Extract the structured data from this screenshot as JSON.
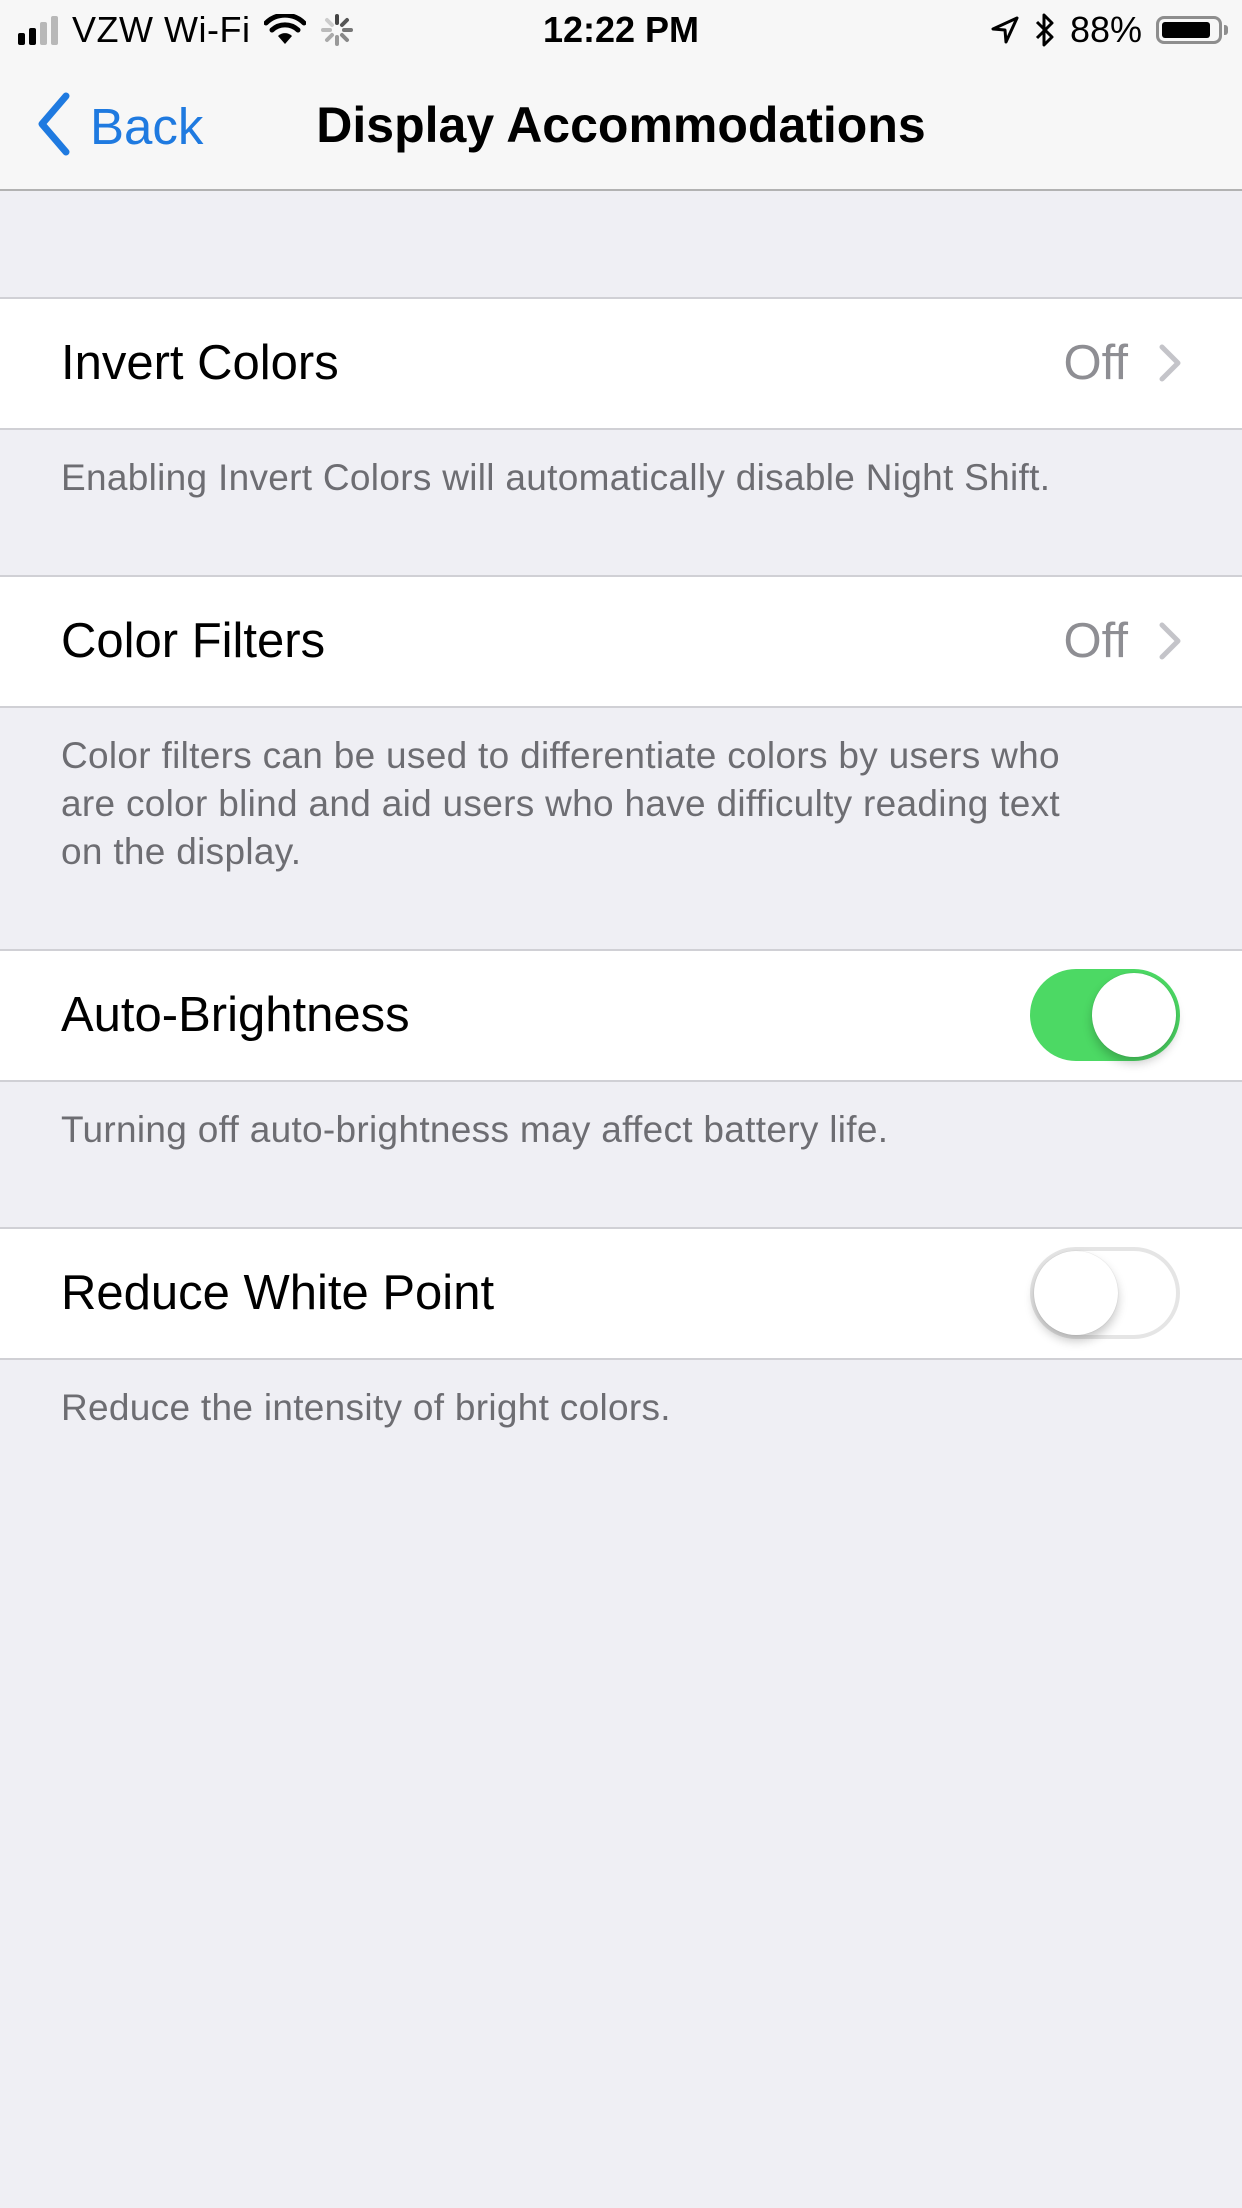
{
  "status_bar": {
    "carrier": "VZW Wi-Fi",
    "time": "12:22 PM",
    "battery_percent": "88%",
    "signal_bars_filled": 2,
    "signal_bars_total": 4,
    "icons": [
      "signal-icon",
      "wifi-icon",
      "activity-spinner-icon",
      "location-arrow-icon",
      "bluetooth-icon",
      "battery-icon"
    ]
  },
  "nav": {
    "back_label": "Back",
    "title": "Display Accommodations"
  },
  "sections": [
    {
      "label": "Invert Colors",
      "type": "disclosure",
      "value": "Off",
      "footer": "Enabling Invert Colors will automatically disable Night Shift."
    },
    {
      "label": "Color Filters",
      "type": "disclosure",
      "value": "Off",
      "footer_lines": [
        "Color filters can be used to differentiate colors by users who",
        "are color blind and aid users who have difficulty reading text",
        "on the display."
      ]
    },
    {
      "label": "Auto-Brightness",
      "type": "toggle",
      "on": true,
      "footer": "Turning off auto-brightness may affect battery life."
    },
    {
      "label": "Reduce White Point",
      "type": "toggle",
      "on": false,
      "footer": "Reduce the intensity of bright colors."
    }
  ],
  "colors": {
    "accent": "#1f7ae0",
    "toggle_on": "#4cd964",
    "background": "#efeff4",
    "secondary_text": "#8e8e93",
    "footer_text": "#6d6d72"
  }
}
